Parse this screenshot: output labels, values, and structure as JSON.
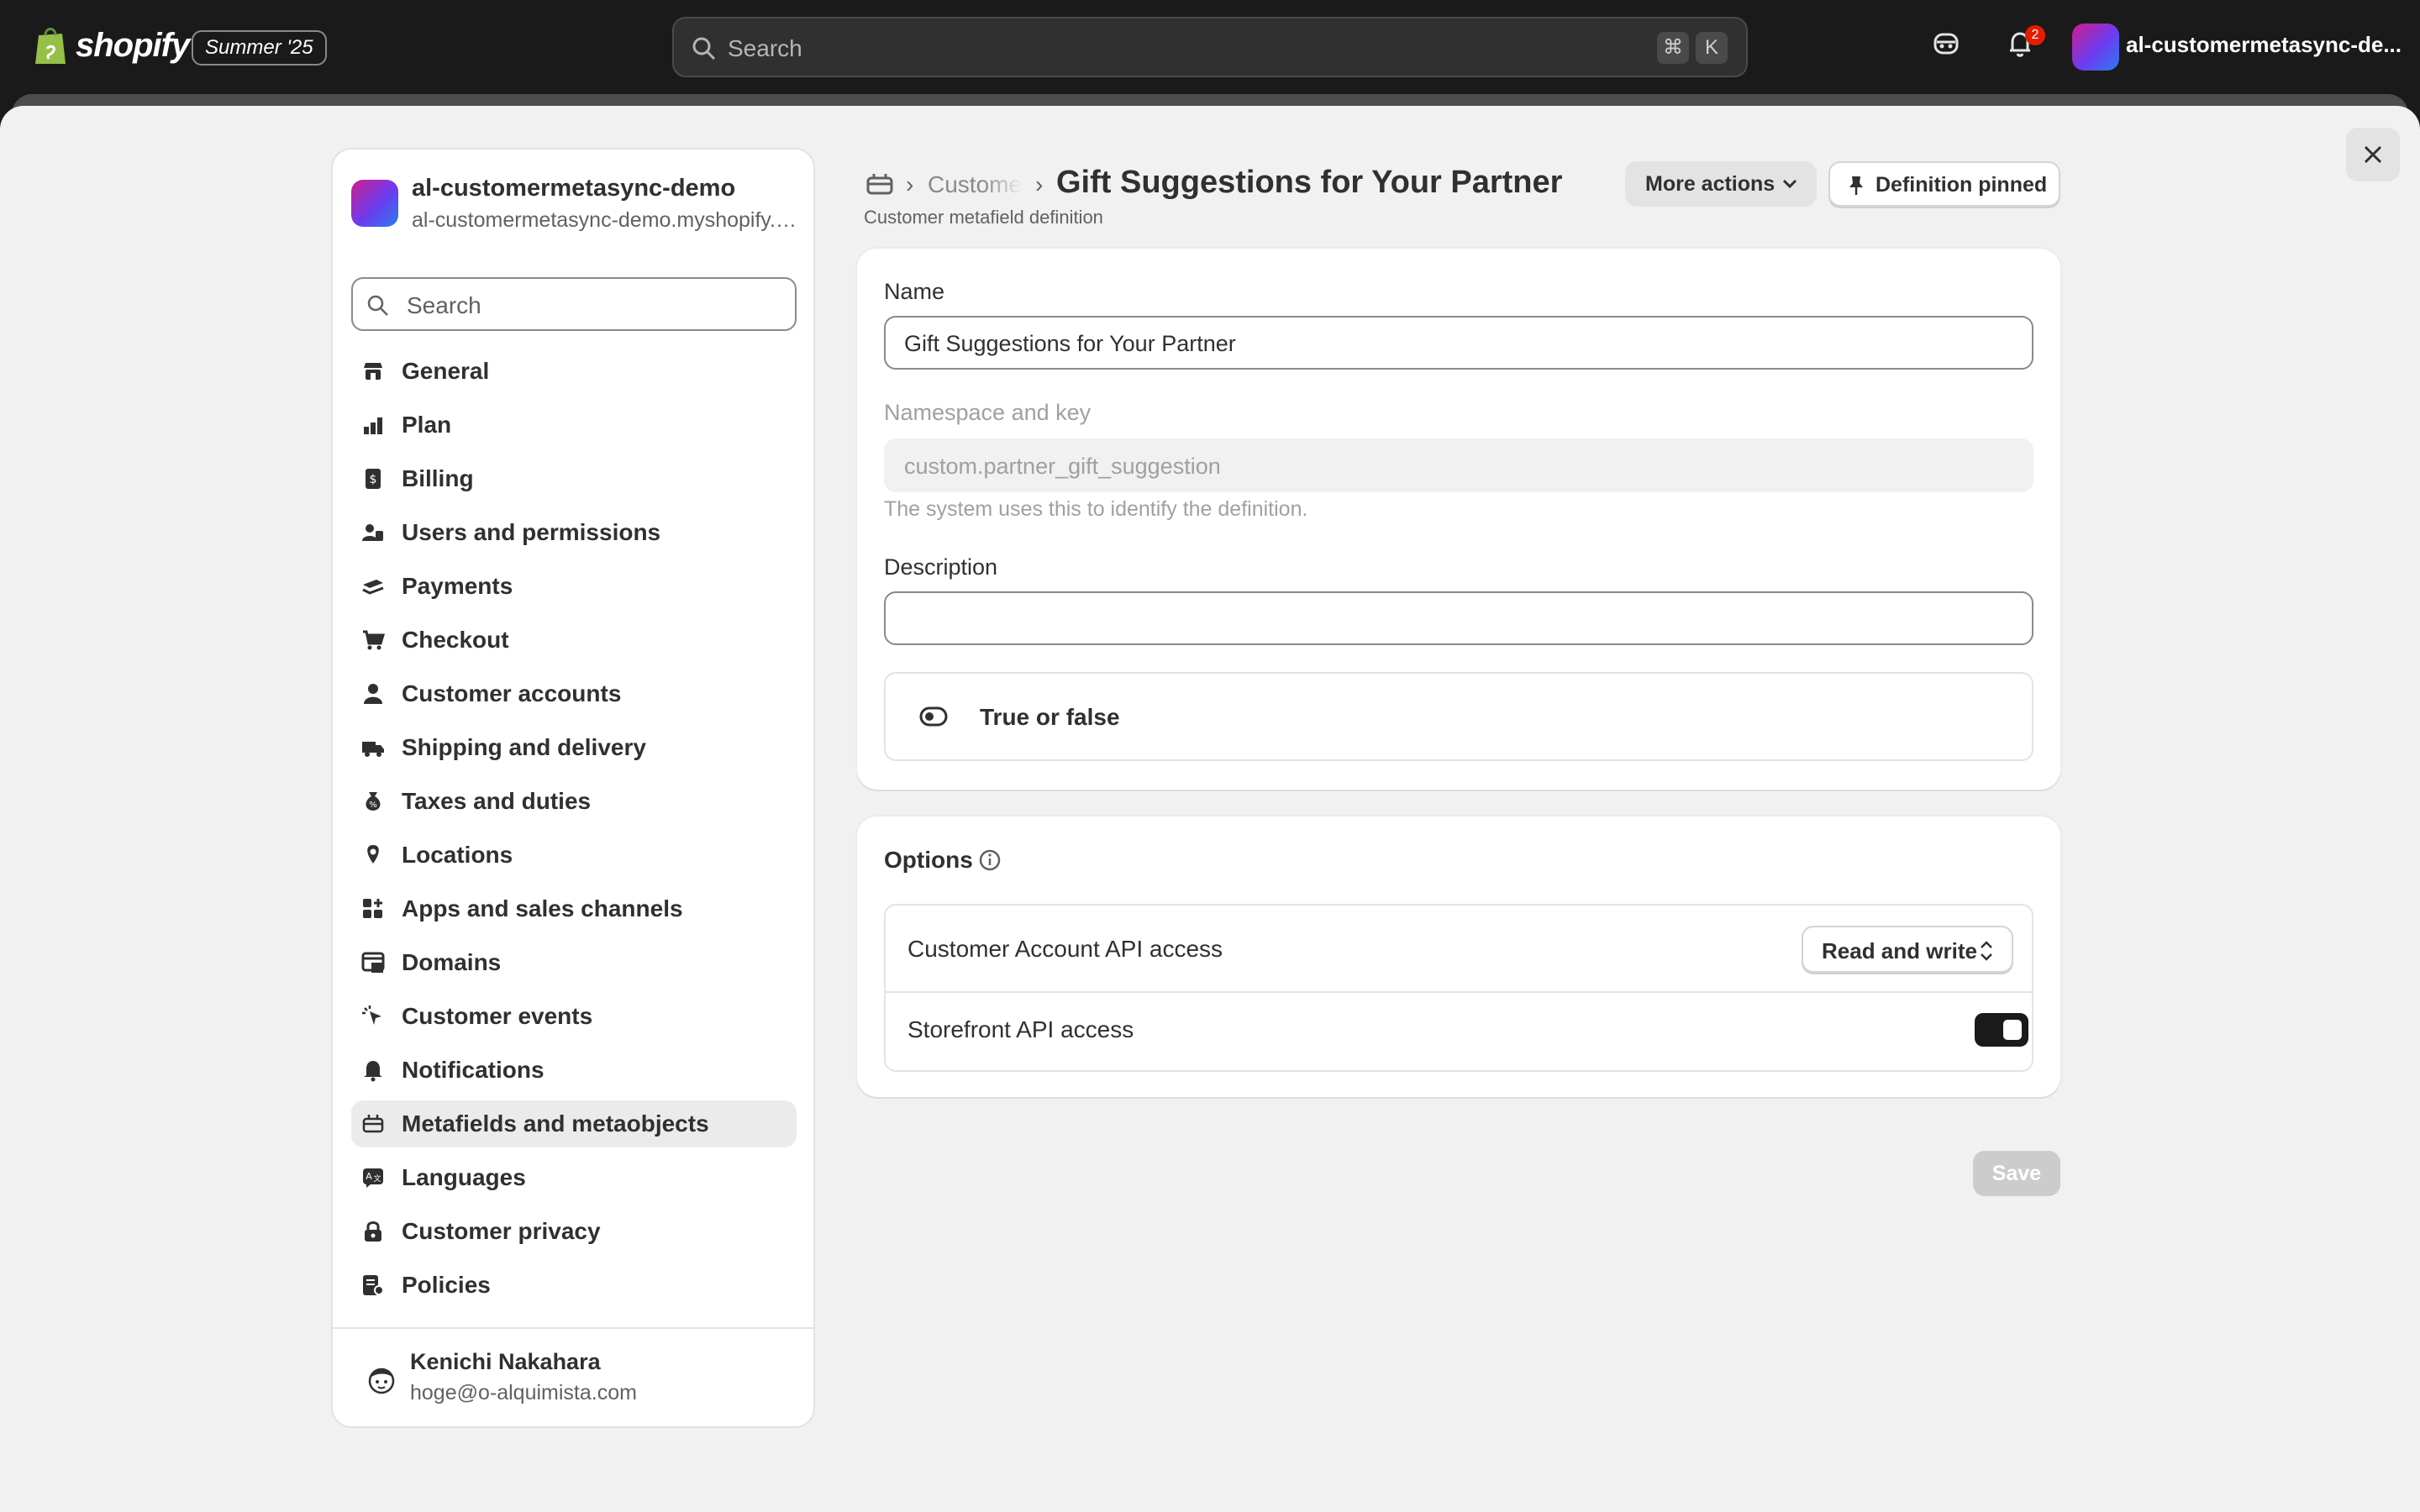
{
  "topbar": {
    "brand": "shopify",
    "edition": "Summer '25",
    "search_placeholder": "Search",
    "shortcut_cmd": "⌘",
    "shortcut_key": "K",
    "notification_count": "2",
    "store_name": "al-customermetasync-de..."
  },
  "sidebar": {
    "store_title": "al-customermetasync-demo",
    "store_domain": "al-customermetasync-demo.myshopify.com",
    "search_placeholder": "Search",
    "items": [
      {
        "label": "General",
        "icon": "store-icon"
      },
      {
        "label": "Plan",
        "icon": "plan-icon"
      },
      {
        "label": "Billing",
        "icon": "billing-icon"
      },
      {
        "label": "Users and permissions",
        "icon": "users-icon"
      },
      {
        "label": "Payments",
        "icon": "payments-icon"
      },
      {
        "label": "Checkout",
        "icon": "cart-icon"
      },
      {
        "label": "Customer accounts",
        "icon": "person-icon"
      },
      {
        "label": "Shipping and delivery",
        "icon": "truck-icon"
      },
      {
        "label": "Taxes and duties",
        "icon": "tax-icon"
      },
      {
        "label": "Locations",
        "icon": "location-icon"
      },
      {
        "label": "Apps and sales channels",
        "icon": "apps-icon"
      },
      {
        "label": "Domains",
        "icon": "domains-icon"
      },
      {
        "label": "Customer events",
        "icon": "cursor-icon"
      },
      {
        "label": "Notifications",
        "icon": "bell-icon"
      },
      {
        "label": "Metafields and metaobjects",
        "icon": "metafields-icon"
      },
      {
        "label": "Languages",
        "icon": "languages-icon"
      },
      {
        "label": "Customer privacy",
        "icon": "lock-icon"
      },
      {
        "label": "Policies",
        "icon": "policies-icon"
      }
    ],
    "user_name": "Kenichi Nakahara",
    "user_email": "hoge@o-alquimista.com"
  },
  "header": {
    "breadcrumb_parent": "Customers",
    "title": "Gift Suggestions for Your Partner",
    "subtitle": "Customer metafield definition",
    "more_actions": "More actions",
    "pinned": "Definition pinned"
  },
  "form": {
    "name_label": "Name",
    "name_value": "Gift Suggestions for Your Partner",
    "ns_label": "Namespace and key",
    "ns_value": "custom.partner_gift_suggestion",
    "ns_help": "The system uses this to identify the definition.",
    "desc_label": "Description",
    "desc_value": "",
    "type_label": "True or false"
  },
  "options": {
    "title": "Options",
    "customer_api_label": "Customer Account API access",
    "customer_api_value": "Read and write",
    "storefront_label": "Storefront API access",
    "storefront_enabled": true
  },
  "actions": {
    "save": "Save"
  },
  "colors": {
    "topbar": "#1a1a1a",
    "page_bg": "#f1f1f1",
    "active_nav": "#ebebeb",
    "badge": "#e51c00"
  }
}
